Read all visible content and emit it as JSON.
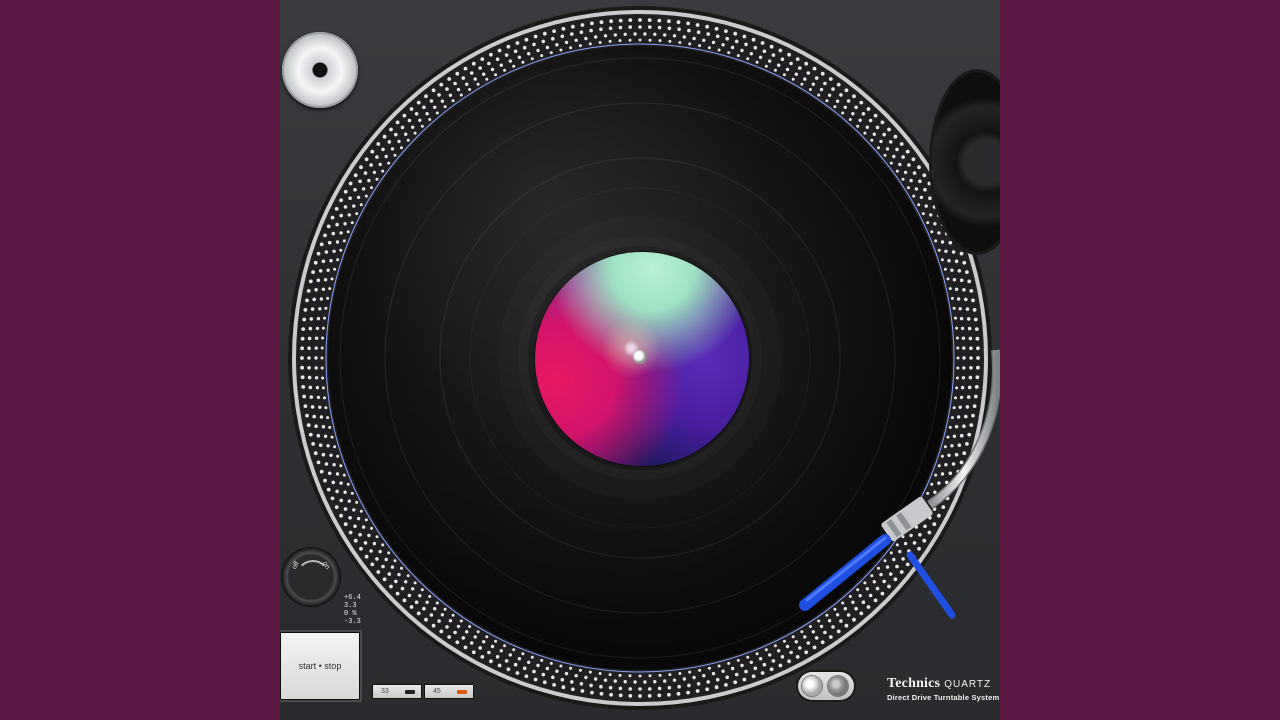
{
  "colors": {
    "background": "#5c1a44",
    "deck": "#303134",
    "vinyl": "#0e0e0f",
    "strobe_dot": "#e6e6e6",
    "headshell": "#1f4fe0",
    "speed_led_active": "#e05a10"
  },
  "controls": {
    "pitch_knob": {
      "off_label": "off",
      "on_label": "on"
    },
    "pitch_scale": [
      "+6.4",
      "3.3",
      "0",
      "-3.3"
    ],
    "pitch_unit": "%",
    "start_stop_label": "start • stop",
    "speed_buttons": [
      {
        "label": "33",
        "active": false
      },
      {
        "label": "45",
        "active": true
      }
    ]
  },
  "icons": {
    "dust_cap": "dust-cap-icon",
    "target_light": "target-light-icon",
    "spindle": "spindle-icon"
  },
  "brand": {
    "name": "Technics",
    "quartz": "QUARTZ",
    "subtitle": "Direct Drive Turntable System"
  }
}
